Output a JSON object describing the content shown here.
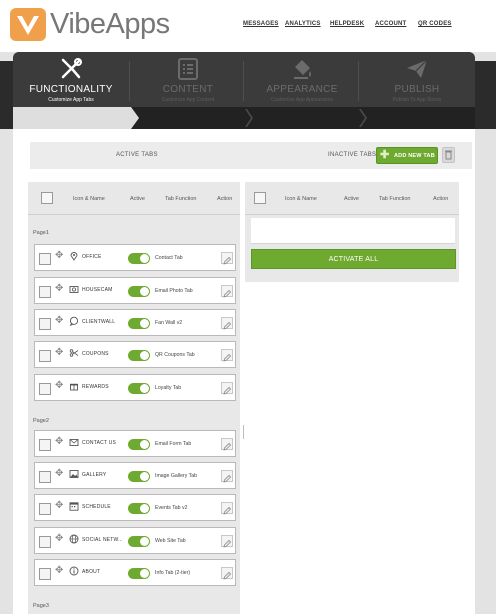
{
  "header": {
    "brand": "VibeApps",
    "nav": [
      "MESSAGES",
      "ANALYTICS",
      "HELPDESK",
      "ACCOUNT",
      "QR CODES"
    ]
  },
  "steps": [
    {
      "title": "FUNCTIONALITY",
      "subtitle": "Customize App Tabs",
      "icon": "tools-icon"
    },
    {
      "title": "CONTENT",
      "subtitle": "Customize App Content",
      "icon": "list-icon"
    },
    {
      "title": "APPEARANCE",
      "subtitle": "Customize App Appearance",
      "icon": "paint-bucket-icon"
    },
    {
      "title": "PUBLISH",
      "subtitle": "Publish To App Stores",
      "icon": "paper-plane-icon"
    }
  ],
  "tabs_header": {
    "active_label": "ACTIVE TABS",
    "inactive_label": "INACTIVE TABS",
    "add_button": "ADD NEW TAB"
  },
  "columns": {
    "icon_name": "Icon & Name",
    "active": "Active",
    "tab_function": "Tab Function",
    "action": "Action"
  },
  "pages": [
    "Page1",
    "Page2",
    "Page3"
  ],
  "active_tabs": [
    {
      "name": "OFFICE",
      "function": "Contact Tab",
      "icon": "map-pin-icon"
    },
    {
      "name": "HOUSECAM",
      "function": "Email Photo Tab",
      "icon": "camera-icon"
    },
    {
      "name": "CLIENTWALL",
      "function": "Fan Wall v2",
      "icon": "chat-bubble-icon"
    },
    {
      "name": "COUPONS",
      "function": "QR Coupons Tab",
      "icon": "scissors-icon"
    },
    {
      "name": "REWARDS",
      "function": "Loyalty Tab",
      "icon": "gift-icon"
    },
    {
      "name": "CONTACT US",
      "function": "Email Form Tab",
      "icon": "envelope-icon"
    },
    {
      "name": "GALLERY",
      "function": "Image Gallery Tab",
      "icon": "image-icon"
    },
    {
      "name": "SCHEDULE",
      "function": "Events Tab v2",
      "icon": "calendar-icon"
    },
    {
      "name": "SOCIAL NETW...",
      "function": "Web Site Tab",
      "icon": "globe-icon"
    },
    {
      "name": "ABOUT",
      "function": "Info Tab (2-tier)",
      "icon": "info-icon"
    }
  ],
  "activate_button": "ACTIVATE ALL",
  "colors": {
    "accent": "#6eaa2f",
    "dark": "#2b2b2b",
    "logo": "#f0a04b"
  }
}
